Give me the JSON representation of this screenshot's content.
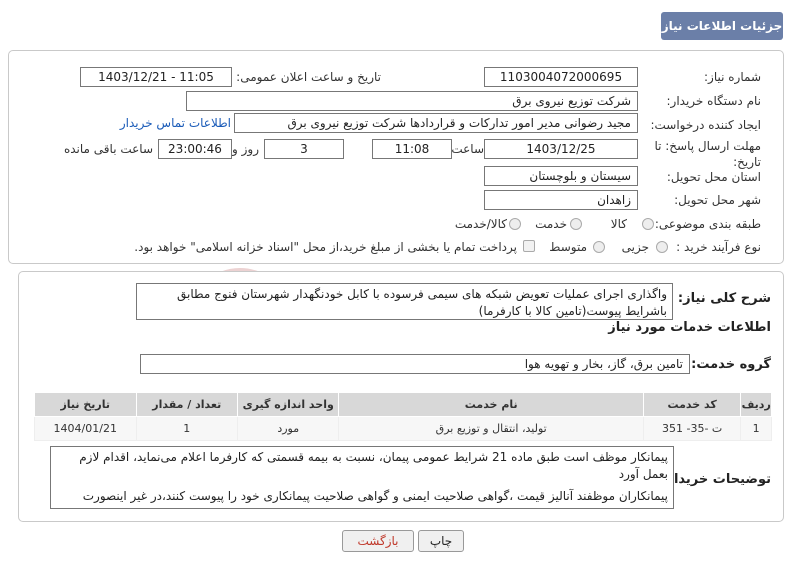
{
  "header": {
    "title": "جزئیات اطلاعات نیاز"
  },
  "form": {
    "need_number_label": "شماره نیاز:",
    "need_number": "1103004072000695",
    "announce_label": "تاریخ و ساعت اعلان عمومی:",
    "announce_value": "1403/12/21 - 11:05",
    "buyer_label": "نام دستگاه خریدار:",
    "buyer_value": "شرکت توزیع نیروی برق",
    "creator_label": "ایجاد کننده درخواست:",
    "creator_value": "مجید  رضوانی مدیر امور تدارکات و قراردادها شرکت توزیع نیروی برق",
    "contact_link": "اطلاعات تماس خریدار",
    "deadline_label": "مهلت ارسال پاسخ: تا تاریخ:",
    "deadline_date": "1403/12/25",
    "time_label": "ساعت",
    "deadline_time": "11:08",
    "days_value": "3",
    "days_label": "روز و",
    "remaining_time": "23:00:46",
    "remaining_label": "ساعت باقی مانده",
    "province_label": "استان محل تحویل:",
    "province_value": "سیستان و بلوچستان",
    "city_label": "شهر محل تحویل:",
    "city_value": "زاهدان",
    "category_label": "طبقه بندی موضوعی:",
    "category_options": [
      "کالا",
      "خدمت",
      "کالا/خدمت"
    ],
    "process_label": "نوع فرآیند خرید :",
    "process_options": [
      "جزیی",
      "متوسط"
    ],
    "payment_note": "پرداخت تمام یا بخشی از مبلغ خرید،از محل \"اسناد خزانه اسلامی\" خواهد بود."
  },
  "details": {
    "summary_label": "شرح کلی نیاز:",
    "summary_text": "واگذاری اجرای عملیات تعویض شبکه های سیمی فرسوده با کابل خودنگهدار شهرستان فنوج مطابق باشرایط پیوست(تامین کالا با کارفرما)",
    "services_heading": "اطلاعات خدمات مورد نیاز",
    "service_group_label": "گروه خدمت:",
    "service_group_value": "تامین برق، گاز، بخار و تهویه هوا",
    "table_headers": [
      "ردیف",
      "کد خدمت",
      "نام خدمت",
      "واحد اندازه گیری",
      "تعداد / مقدار",
      "تاریخ نیاز"
    ],
    "table_rows": [
      [
        "1",
        "ت -35- 351",
        "تولید، انتقال و توزیع برق",
        "مورد",
        "1",
        "1404/01/21"
      ]
    ],
    "buyer_notes_label": "توضیحات خریدار:",
    "buyer_notes_line1": "پیمانکار موظف است طبق ماده 21 شرایط عمومی پیمان، نسبت به بیمه قسمتی که کارفرما اعلام می‌نماید، اقدام لازم بعمل آورد",
    "buyer_notes_line2": "پیمانکاران موظفند آنالیز قیمت ،گواهی صلاحیت ایمنی و گواهی صلاحیت پیمانکاری خود را پیوست کنند،در غیر اینصورت"
  },
  "buttons": {
    "print": "چاپ",
    "back": "بازگشت"
  },
  "colors": {
    "header_bg": "#6b7fa8",
    "link": "#1a5bb8",
    "watermark": "#e8c9c9"
  }
}
